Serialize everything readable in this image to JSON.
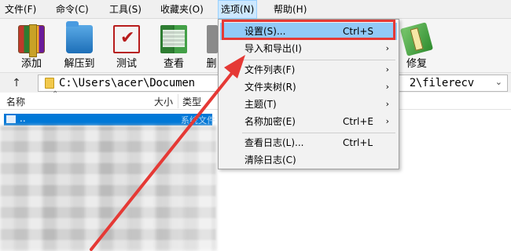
{
  "menubar": {
    "items": [
      "文件(F)",
      "命令(C)",
      "工具(S)",
      "收藏夹(O)",
      "选项(N)",
      "帮助(H)"
    ],
    "active_index": 4
  },
  "toolbar": {
    "buttons": [
      {
        "label": "添加",
        "icon": "archive-add-icon"
      },
      {
        "label": "解压到",
        "icon": "extract-folder-icon"
      },
      {
        "label": "测试",
        "icon": "test-check-icon"
      },
      {
        "label": "查看",
        "icon": "view-book-icon"
      },
      {
        "label": "删",
        "icon": "delete-icon"
      },
      {
        "label": "修复",
        "icon": "repair-icon"
      }
    ]
  },
  "address": {
    "path_left": "C:\\Users\\acer\\Documen",
    "path_right": "2\\filerecv"
  },
  "columns": {
    "name": "名称",
    "size": "大小",
    "type": "类型"
  },
  "selected_row": {
    "name": "..",
    "type": "系统文件"
  },
  "dropdown": {
    "items": [
      {
        "label": "设置(S)...",
        "shortcut": "Ctrl+S",
        "submenu": false
      },
      {
        "label": "导入和导出(I)",
        "shortcut": "",
        "submenu": true
      },
      {
        "label": "文件列表(F)",
        "shortcut": "",
        "submenu": true
      },
      {
        "label": "文件夹树(R)",
        "shortcut": "",
        "submenu": true
      },
      {
        "label": "主题(T)",
        "shortcut": "",
        "submenu": true
      },
      {
        "label": "名称加密(E)",
        "shortcut": "Ctrl+E",
        "submenu": true
      },
      {
        "label": "查看日志(L)...",
        "shortcut": "Ctrl+L",
        "submenu": false
      },
      {
        "label": "清除日志(C)",
        "shortcut": "",
        "submenu": false
      }
    ],
    "submenu_glyph": "›"
  },
  "colors": {
    "highlight_box": "#e53935",
    "selection": "#0078d7",
    "menu_hover": "#91c9f7"
  }
}
